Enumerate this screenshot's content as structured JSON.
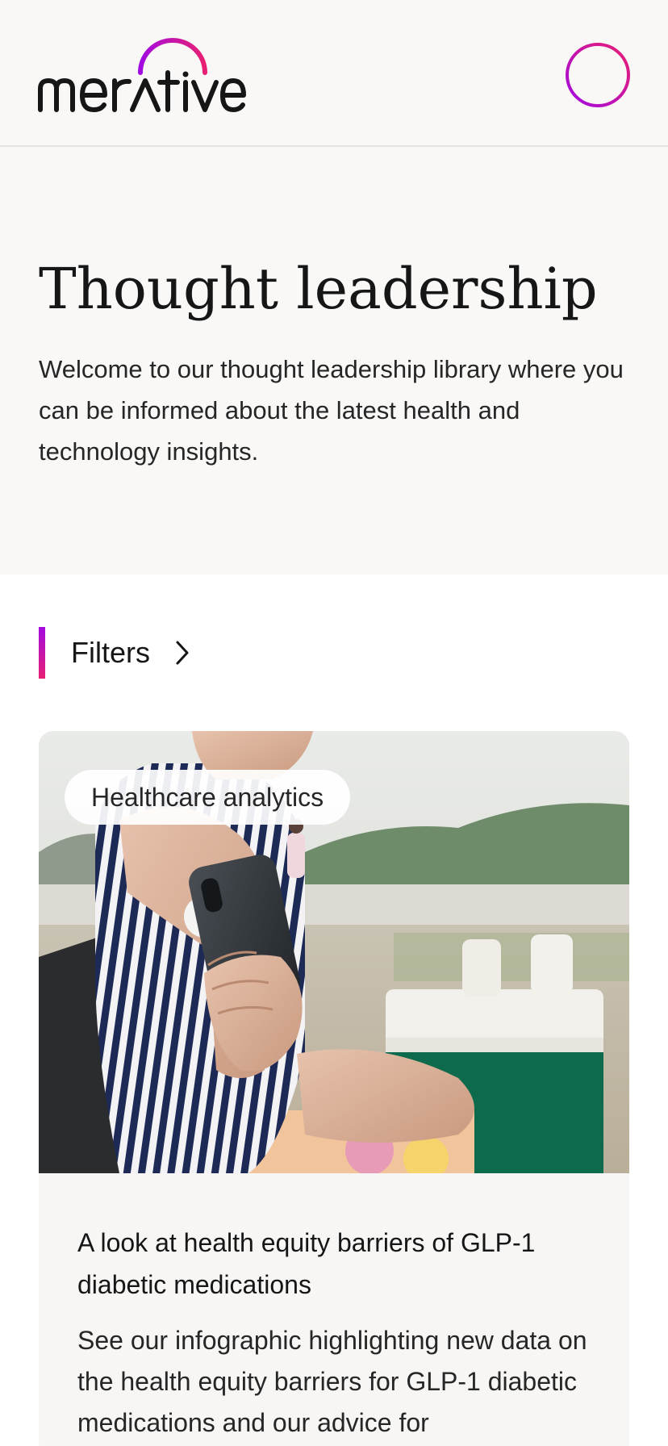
{
  "header": {
    "logo_text": "merative",
    "logo_icon": "merative-arc-logo",
    "menu_icon": "hamburger-menu-icon",
    "brand_gradient": [
      "#a20ae0",
      "#e81f73"
    ]
  },
  "hero": {
    "title": "Thought leadership",
    "description": "Welcome to our thought leadership library where you can be informed about the latest health and technology insights."
  },
  "filters": {
    "label": "Filters",
    "icon": "chevron-right-icon"
  },
  "cards": [
    {
      "tag": "Healthcare analytics",
      "title": "A look at health equity barriers of GLP-1 diabetic medications",
      "description": "See our infographic highlighting new data on the health equity barriers for GLP-1 diabetic medications and our advice for"
    }
  ]
}
